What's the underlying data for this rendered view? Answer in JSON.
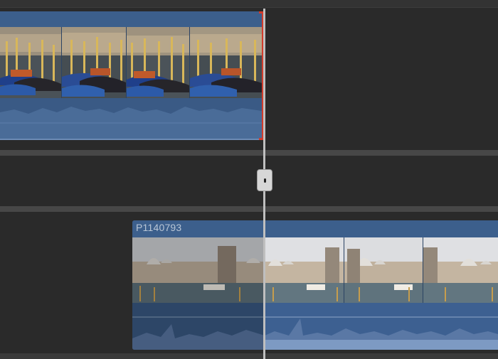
{
  "timeline": {
    "lower_clip": {
      "title": "P1140793"
    }
  },
  "icons": {
    "playhead": "playhead-handle-icon",
    "trim_edge": "trim-edge-icon"
  },
  "colors": {
    "background": "#2a2a2a",
    "lane_separator": "#474747",
    "clip_header": "#3c5f8c",
    "audio_blue": "#3a5a85",
    "selected_audio": "#6b8fbf",
    "trim_edge": "#d23b2b",
    "playhead": "#bfbfbf"
  }
}
